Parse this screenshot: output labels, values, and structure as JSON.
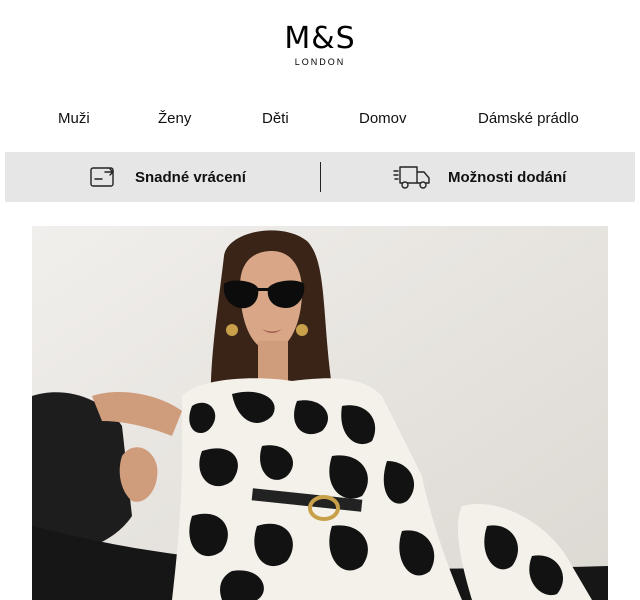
{
  "brand": {
    "name": "M&S",
    "sub": "LONDON"
  },
  "nav": [
    {
      "label": "Muži"
    },
    {
      "label": "Ženy"
    },
    {
      "label": "Děti"
    },
    {
      "label": "Domov"
    },
    {
      "label": "Dámské prádlo"
    }
  ],
  "services": [
    {
      "label": "Snadné vrácení",
      "icon": "return-box-icon"
    },
    {
      "label": "Možnosti dodání",
      "icon": "delivery-truck-icon"
    }
  ],
  "hero": {
    "icon": "hero-photo"
  }
}
